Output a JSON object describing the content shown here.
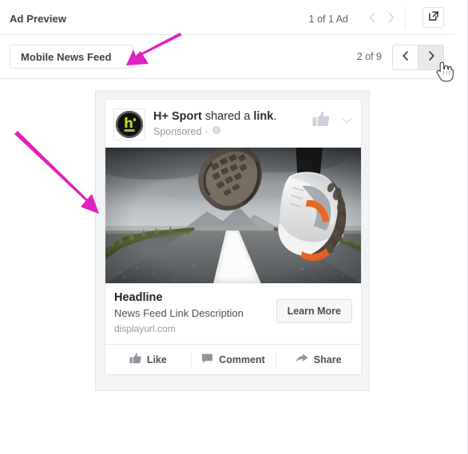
{
  "header": {
    "title": "Ad Preview",
    "ad_count": "1 of 1 Ad",
    "prev_icon": "chevron-left-icon",
    "next_icon": "chevron-right-icon",
    "expand_icon": "external-link-icon"
  },
  "tabbar": {
    "selected_placement": "Mobile News Feed",
    "page_count": "2 of 9",
    "prev_icon": "chevron-left-icon",
    "next_icon": "chevron-right-icon"
  },
  "ad": {
    "avatar_letter": "h",
    "page_name": "H+ Sport",
    "action_text": " shared a ",
    "object_text": "link",
    "period": ".",
    "sponsored_label": "Sponsored",
    "separator": "·",
    "audience_icon": "globe-icon",
    "like_thumb_icon": "thumbs-up-icon",
    "menu_icon": "chevron-down-icon",
    "image_alt": "running-shoes-on-road-photo",
    "headline": "Headline",
    "description": "News Feed Link Description",
    "display_url": "displayurl.com",
    "cta_label": "Learn More",
    "actions": [
      {
        "label": "Like",
        "icon": "thumbs-up-icon"
      },
      {
        "label": "Comment",
        "icon": "speech-bubble-icon"
      },
      {
        "label": "Share",
        "icon": "share-arrow-icon"
      }
    ]
  },
  "annotations": {
    "arrow_color": "#e020c0",
    "arrow_1_name": "arrow-pointing-to-placement-tab",
    "arrow_2_name": "arrow-pointing-to-ad-image"
  },
  "cursor": {
    "type": "pointing-hand-cursor"
  }
}
